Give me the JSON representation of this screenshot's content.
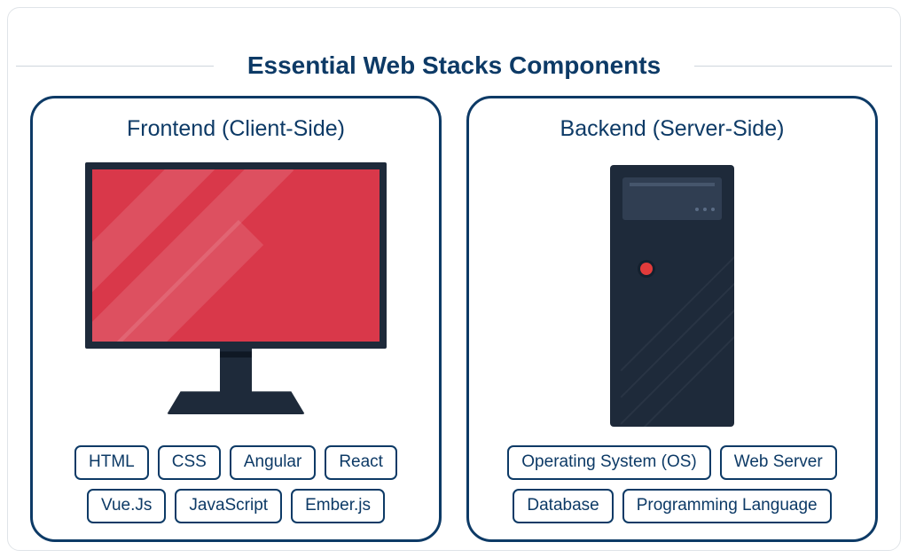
{
  "title": "Essential Web Stacks Components",
  "frontend": {
    "heading": "Frontend (Client-Side)",
    "tags": [
      "HTML",
      "CSS",
      "Angular",
      "React",
      "Vue.Js",
      "JavaScript",
      "Ember.js"
    ]
  },
  "backend": {
    "heading": "Backend (Server-Side)",
    "tags": [
      "Operating System (OS)",
      "Web Server",
      "Database",
      "Programming Language"
    ]
  }
}
